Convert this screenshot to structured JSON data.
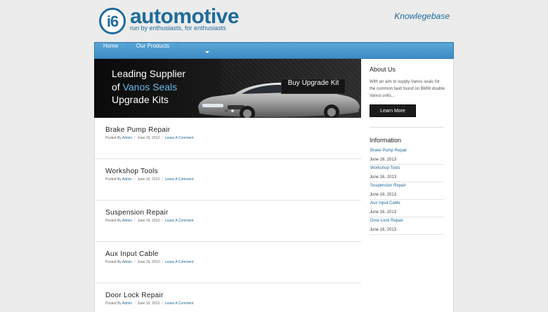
{
  "brand": {
    "logo_mark": "i6",
    "logo_text": "automotive",
    "tagline": "run by enthusiasts, for enthusiasts"
  },
  "header_link": "Knowlegebase",
  "nav": [
    {
      "label": "Home"
    },
    {
      "label": "Our Products"
    }
  ],
  "banner": {
    "line1": "Leading Supplier",
    "line2_prefix": "of ",
    "line2_accent": "Vanos Seals",
    "line3": "Upgrade Kits",
    "button": "Buy Upgrade Kit"
  },
  "posts": [
    {
      "title": "Brake Pump Repair",
      "posted_by": "Posted By",
      "author": "Admin",
      "date": "June 16, 2013",
      "comment": "Leave A Comment"
    },
    {
      "title": "Workshop Tools",
      "posted_by": "Posted By",
      "author": "Admin",
      "date": "June 16, 2013",
      "comment": "Leave A Comment"
    },
    {
      "title": "Suspension Repair",
      "posted_by": "Posted By",
      "author": "Admin",
      "date": "June 16, 2013",
      "comment": "Leave A Comment"
    },
    {
      "title": "Aux Input Cable",
      "posted_by": "Posted By",
      "author": "Admin",
      "date": "June 16, 2013",
      "comment": "Leave A Comment"
    },
    {
      "title": "Door Lock Repair",
      "posted_by": "Posted By",
      "author": "Admin",
      "date": "June 16, 2013",
      "comment": "Leave A Comment"
    }
  ],
  "sidebar": {
    "about_title": "About Us",
    "about_text": "With an aim to supply Vanos seals for the common fault found on BMW double Vanos units...",
    "learn_more": "Learn More",
    "info_title": "Information",
    "info": [
      {
        "label": "Brake Pump Repair",
        "date": "June 16, 2013"
      },
      {
        "label": "Workshop Tools",
        "date": "June 16, 2013"
      },
      {
        "label": "Suspension Repair",
        "date": "June 16, 2013"
      },
      {
        "label": "Aux Input Cable",
        "date": "June 16, 2013"
      },
      {
        "label": "Door Lock Repair",
        "date": "June 16, 2013"
      }
    ]
  },
  "colors": {
    "brand_blue": "#1e6b9c",
    "nav_blue": "#4a98cd",
    "banner_accent": "#6cb8ea"
  }
}
